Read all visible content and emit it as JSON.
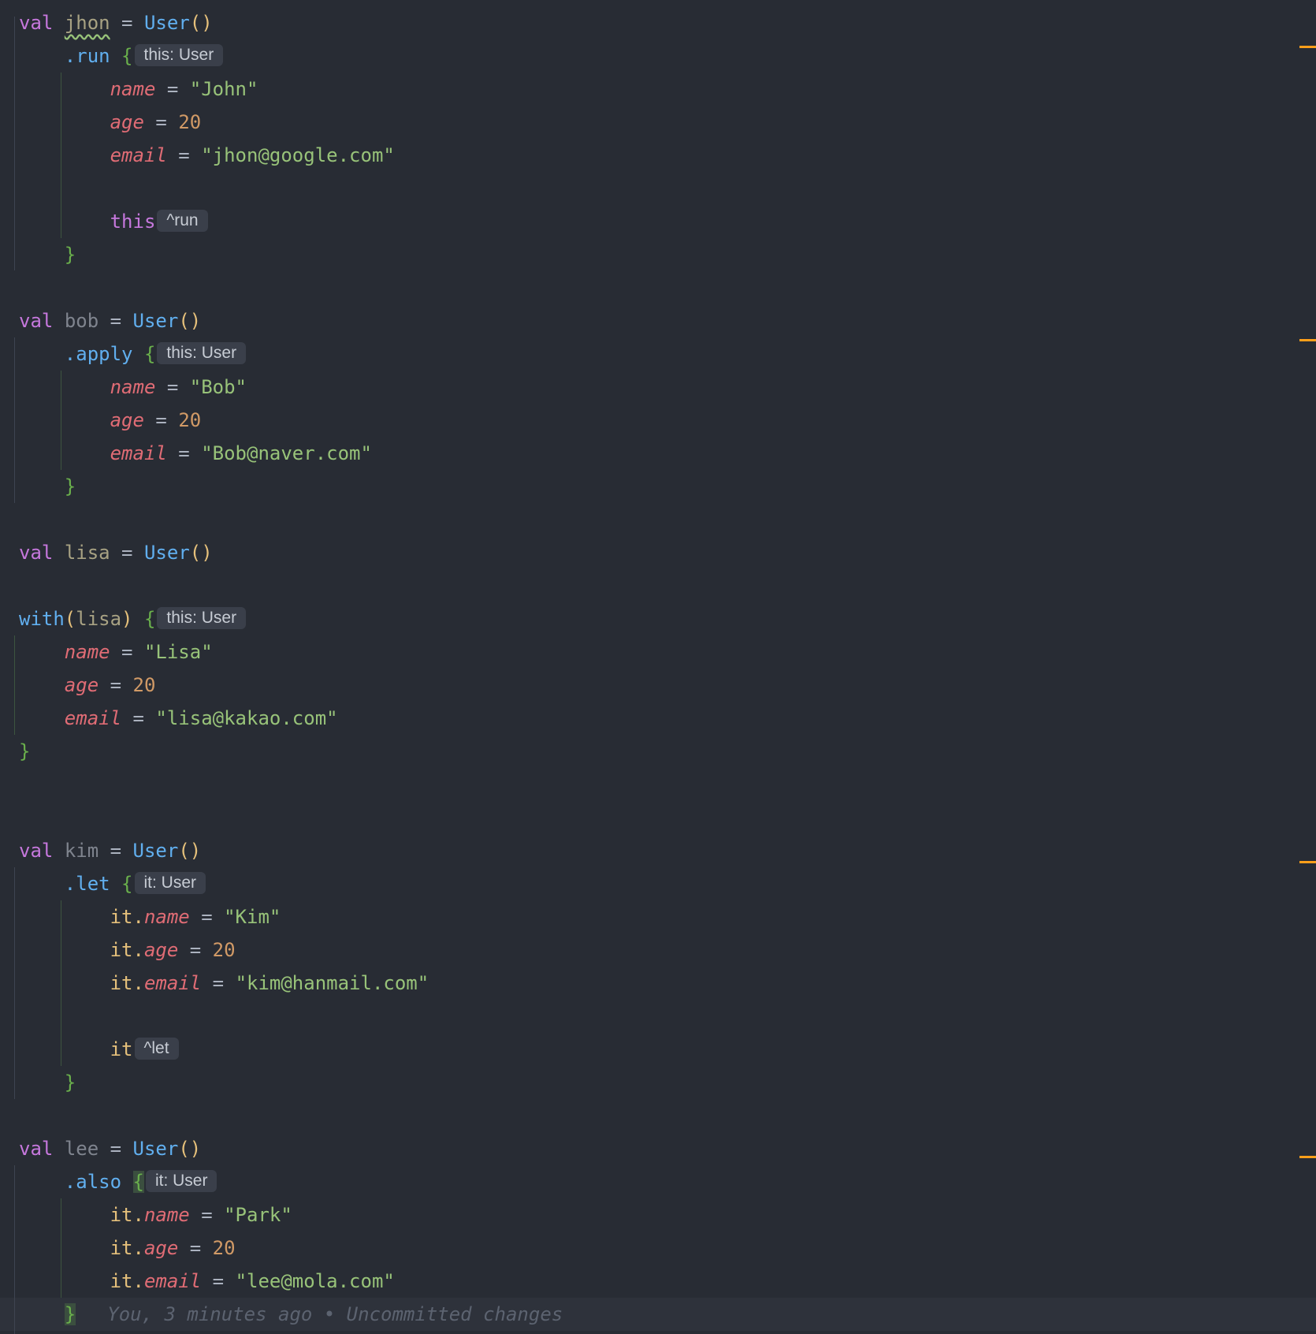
{
  "editor": {
    "lines": [
      {
        "tokens": [
          {
            "t": "val",
            "c": "kw"
          },
          {
            "t": " ",
            "c": "op"
          },
          {
            "t": "jhon",
            "c": "var olive wavy"
          },
          {
            "t": " = ",
            "c": "op"
          },
          {
            "t": "User",
            "c": "fn"
          },
          {
            "t": "()",
            "c": "paren"
          }
        ]
      },
      {
        "tokens": [
          {
            "t": "    ",
            "c": "op"
          },
          {
            "t": ".run",
            "c": "fn"
          },
          {
            "t": " ",
            "c": "op"
          },
          {
            "t": "{",
            "c": "brace"
          },
          {
            "t": "this: User",
            "c": "hint"
          }
        ]
      },
      {
        "tokens": [
          {
            "t": "        ",
            "c": "op"
          },
          {
            "t": "name",
            "c": "prop"
          },
          {
            "t": " = ",
            "c": "op"
          },
          {
            "t": "\"John\"",
            "c": "str"
          }
        ]
      },
      {
        "tokens": [
          {
            "t": "        ",
            "c": "op"
          },
          {
            "t": "age",
            "c": "prop"
          },
          {
            "t": " = ",
            "c": "op"
          },
          {
            "t": "20",
            "c": "num"
          }
        ]
      },
      {
        "tokens": [
          {
            "t": "        ",
            "c": "op"
          },
          {
            "t": "email",
            "c": "prop"
          },
          {
            "t": " = ",
            "c": "op"
          },
          {
            "t": "\"jhon@google.com\"",
            "c": "str"
          }
        ]
      },
      {
        "tokens": []
      },
      {
        "tokens": [
          {
            "t": "        ",
            "c": "op"
          },
          {
            "t": "this",
            "c": "kw"
          },
          {
            "t": "^run",
            "c": "hint"
          }
        ]
      },
      {
        "tokens": [
          {
            "t": "    ",
            "c": "op"
          },
          {
            "t": "}",
            "c": "brace"
          }
        ]
      },
      {
        "tokens": []
      },
      {
        "tokens": [
          {
            "t": "val",
            "c": "kw"
          },
          {
            "t": " ",
            "c": "op"
          },
          {
            "t": "bob",
            "c": "var"
          },
          {
            "t": " = ",
            "c": "op"
          },
          {
            "t": "User",
            "c": "fn"
          },
          {
            "t": "()",
            "c": "paren"
          }
        ]
      },
      {
        "tokens": [
          {
            "t": "    ",
            "c": "op"
          },
          {
            "t": ".apply",
            "c": "fn"
          },
          {
            "t": " ",
            "c": "op"
          },
          {
            "t": "{",
            "c": "brace"
          },
          {
            "t": "this: User",
            "c": "hint"
          }
        ]
      },
      {
        "tokens": [
          {
            "t": "        ",
            "c": "op"
          },
          {
            "t": "name",
            "c": "prop"
          },
          {
            "t": " = ",
            "c": "op"
          },
          {
            "t": "\"Bob\"",
            "c": "str"
          }
        ]
      },
      {
        "tokens": [
          {
            "t": "        ",
            "c": "op"
          },
          {
            "t": "age",
            "c": "prop"
          },
          {
            "t": " = ",
            "c": "op"
          },
          {
            "t": "20",
            "c": "num"
          }
        ]
      },
      {
        "tokens": [
          {
            "t": "        ",
            "c": "op"
          },
          {
            "t": "email",
            "c": "prop"
          },
          {
            "t": " = ",
            "c": "op"
          },
          {
            "t": "\"Bob@naver.com\"",
            "c": "str"
          }
        ]
      },
      {
        "tokens": [
          {
            "t": "    ",
            "c": "op"
          },
          {
            "t": "}",
            "c": "brace"
          }
        ]
      },
      {
        "tokens": []
      },
      {
        "tokens": [
          {
            "t": "val",
            "c": "kw"
          },
          {
            "t": " ",
            "c": "op"
          },
          {
            "t": "lisa",
            "c": "var olive"
          },
          {
            "t": " = ",
            "c": "op"
          },
          {
            "t": "User",
            "c": "fn"
          },
          {
            "t": "()",
            "c": "paren"
          }
        ]
      },
      {
        "tokens": []
      },
      {
        "tokens": [
          {
            "t": "with",
            "c": "fn"
          },
          {
            "t": "(",
            "c": "paren"
          },
          {
            "t": "lisa",
            "c": "var olive"
          },
          {
            "t": ")",
            "c": "paren"
          },
          {
            "t": " ",
            "c": "op"
          },
          {
            "t": "{",
            "c": "brace"
          },
          {
            "t": "this: User",
            "c": "hint"
          }
        ]
      },
      {
        "tokens": [
          {
            "t": "    ",
            "c": "op"
          },
          {
            "t": "name",
            "c": "prop"
          },
          {
            "t": " = ",
            "c": "op"
          },
          {
            "t": "\"Lisa\"",
            "c": "str"
          }
        ]
      },
      {
        "tokens": [
          {
            "t": "    ",
            "c": "op"
          },
          {
            "t": "age",
            "c": "prop"
          },
          {
            "t": " = ",
            "c": "op"
          },
          {
            "t": "20",
            "c": "num"
          }
        ]
      },
      {
        "tokens": [
          {
            "t": "    ",
            "c": "op"
          },
          {
            "t": "email",
            "c": "prop"
          },
          {
            "t": " = ",
            "c": "op"
          },
          {
            "t": "\"lisa@kakao.com\"",
            "c": "str"
          }
        ]
      },
      {
        "tokens": [
          {
            "t": "}",
            "c": "brace"
          }
        ]
      },
      {
        "tokens": []
      },
      {
        "tokens": []
      },
      {
        "tokens": [
          {
            "t": "val",
            "c": "kw"
          },
          {
            "t": " ",
            "c": "op"
          },
          {
            "t": "kim",
            "c": "var"
          },
          {
            "t": " = ",
            "c": "op"
          },
          {
            "t": "User",
            "c": "fn"
          },
          {
            "t": "()",
            "c": "paren"
          }
        ]
      },
      {
        "tokens": [
          {
            "t": "    ",
            "c": "op"
          },
          {
            "t": ".let",
            "c": "fn"
          },
          {
            "t": " ",
            "c": "op"
          },
          {
            "t": "{",
            "c": "brace"
          },
          {
            "t": "it: User",
            "c": "hint"
          }
        ]
      },
      {
        "tokens": [
          {
            "t": "        ",
            "c": "op"
          },
          {
            "t": "it.",
            "c": "it"
          },
          {
            "t": "name",
            "c": "prop"
          },
          {
            "t": " = ",
            "c": "op"
          },
          {
            "t": "\"Kim\"",
            "c": "str"
          }
        ]
      },
      {
        "tokens": [
          {
            "t": "        ",
            "c": "op"
          },
          {
            "t": "it.",
            "c": "it"
          },
          {
            "t": "age",
            "c": "prop"
          },
          {
            "t": " = ",
            "c": "op"
          },
          {
            "t": "20",
            "c": "num"
          }
        ]
      },
      {
        "tokens": [
          {
            "t": "        ",
            "c": "op"
          },
          {
            "t": "it.",
            "c": "it"
          },
          {
            "t": "email",
            "c": "prop"
          },
          {
            "t": " = ",
            "c": "op"
          },
          {
            "t": "\"kim@hanmail.com\"",
            "c": "str"
          }
        ]
      },
      {
        "tokens": []
      },
      {
        "tokens": [
          {
            "t": "        ",
            "c": "op"
          },
          {
            "t": "it",
            "c": "it"
          },
          {
            "t": "^let",
            "c": "hint"
          }
        ]
      },
      {
        "tokens": [
          {
            "t": "    ",
            "c": "op"
          },
          {
            "t": "}",
            "c": "brace"
          }
        ]
      },
      {
        "tokens": []
      },
      {
        "tokens": [
          {
            "t": "val",
            "c": "kw"
          },
          {
            "t": " ",
            "c": "op"
          },
          {
            "t": "lee",
            "c": "var"
          },
          {
            "t": " = ",
            "c": "op"
          },
          {
            "t": "User",
            "c": "fn"
          },
          {
            "t": "()",
            "c": "paren"
          }
        ]
      },
      {
        "tokens": [
          {
            "t": "    ",
            "c": "op"
          },
          {
            "t": ".also",
            "c": "fn"
          },
          {
            "t": " ",
            "c": "op"
          },
          {
            "t": "{",
            "c": "brace hl"
          },
          {
            "t": "it: User",
            "c": "hint"
          }
        ]
      },
      {
        "tokens": [
          {
            "t": "        ",
            "c": "op"
          },
          {
            "t": "it.",
            "c": "it"
          },
          {
            "t": "name",
            "c": "prop"
          },
          {
            "t": " = ",
            "c": "op"
          },
          {
            "t": "\"Park\"",
            "c": "str"
          }
        ]
      },
      {
        "tokens": [
          {
            "t": "        ",
            "c": "op"
          },
          {
            "t": "it.",
            "c": "it"
          },
          {
            "t": "age",
            "c": "prop"
          },
          {
            "t": " = ",
            "c": "op"
          },
          {
            "t": "20",
            "c": "num"
          }
        ]
      },
      {
        "tokens": [
          {
            "t": "        ",
            "c": "op"
          },
          {
            "t": "it.",
            "c": "it"
          },
          {
            "t": "email",
            "c": "prop"
          },
          {
            "t": " = ",
            "c": "op"
          },
          {
            "t": "\"lee@mola.com\"",
            "c": "str"
          }
        ]
      },
      {
        "tokens": [
          {
            "t": "    ",
            "c": "op"
          },
          {
            "t": "}",
            "c": "brace hl"
          },
          {
            "t": "You, 3 minutes ago • Uncommitted changes",
            "c": "blame"
          }
        ]
      }
    ],
    "current_line": 39
  },
  "colors": {
    "background": "#282c34",
    "current_line": "#2e323b",
    "change_marker": "#ff9f1a"
  }
}
